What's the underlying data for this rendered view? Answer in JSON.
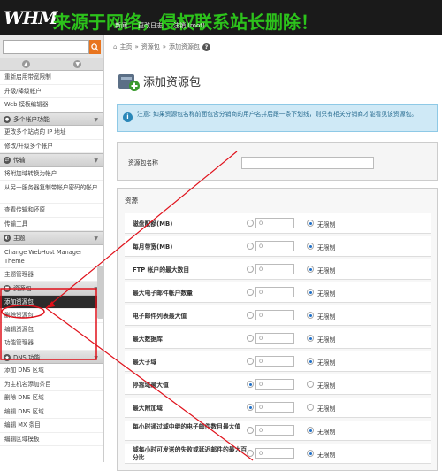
{
  "header": {
    "logo": "WHM",
    "watermark": "来源于网络，侵权联系站长删除！",
    "nav": [
      "新闻",
      "更改日志",
      "注销 (root)"
    ]
  },
  "sidebar": {
    "search_placeholder": "",
    "items_top": [
      "重新启用带宽限制",
      "升级/降级帐户",
      "Web 模板编辑器"
    ],
    "group_multi": "多个帐户功能",
    "items_multi": [
      "更改多个站点的 IP 地址",
      "修改/升级多个帐户"
    ],
    "group_transfer": "传输",
    "items_transfer": [
      "将附加域转换为帐户",
      "从另一服务器复制带帐户密码的帐户",
      "查看传输和还原",
      "传输工具"
    ],
    "group_theme": "主题",
    "items_theme": [
      "Change WebHost Manager Theme",
      "主题管理器"
    ],
    "group_packages": "资源包",
    "items_packages": [
      "添加资源包",
      "删除资源包",
      "编辑资源包",
      "功能管理器"
    ],
    "group_dns": "DNS 功能",
    "items_dns": [
      "添加 DNS 区域",
      "为主机名添加条目",
      "删除 DNS 区域",
      "编辑 DNS 区域",
      "编辑 MX 条目",
      "编辑区域模板"
    ]
  },
  "breadcrumb": {
    "home": "主页",
    "section": "资源包",
    "current": "添加资源包"
  },
  "page": {
    "title": "添加资源包",
    "notice": "注意: 如果资源包名称前面包含分销商的用户名并后跟一条下划线，则只有相关分销商才能看见该资源包。",
    "name_label": "资源包名称",
    "resources_title": "资源",
    "unlimited": "无限制",
    "rows": [
      {
        "label": "磁盘配额(MB)",
        "value": "0"
      },
      {
        "label": "每月带宽(MB)",
        "value": "0"
      },
      {
        "label": "FTP 帐户的最大数目",
        "value": "0"
      },
      {
        "label": "最大电子邮件帐户数量",
        "value": "0"
      },
      {
        "label": "电子邮件列表最大值",
        "value": "0"
      },
      {
        "label": "最大数据库",
        "value": "0"
      },
      {
        "label": "最大子域",
        "value": "0"
      },
      {
        "label": "停靠域最大值",
        "value": "0"
      },
      {
        "label": "最大附加域",
        "value": "0"
      },
      {
        "label": "每小时通过域中继的电子邮件数目最大值",
        "value": "0"
      },
      {
        "label": "域每小时可发送的失败或延迟邮件的最大百分比",
        "value": "0"
      }
    ]
  },
  "colors": {
    "accent": "#e8741e",
    "highlight": "#e0101a",
    "watermark": "#2cc21b"
  }
}
